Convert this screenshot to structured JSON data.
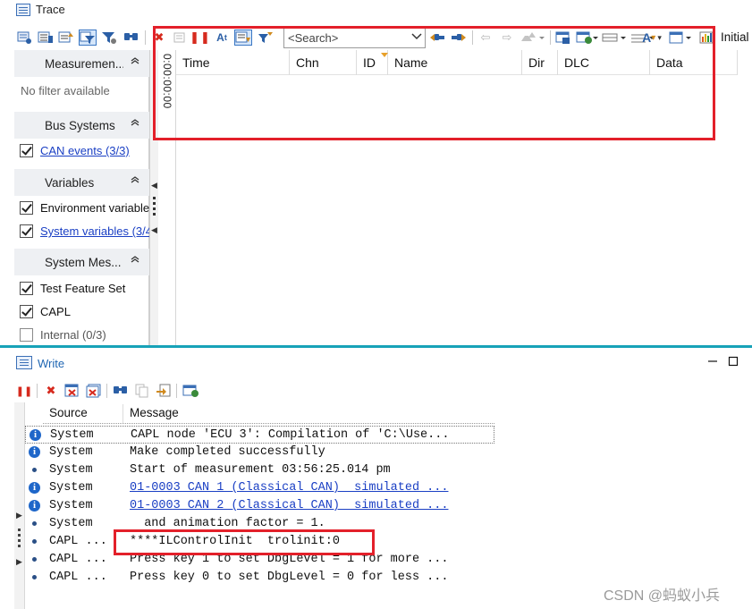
{
  "trace": {
    "title": "Trace",
    "search_placeholder": "<Search>",
    "initial_label": "Initial",
    "filter_pane": {
      "measurement_header": "Measuremen...",
      "no_filter_text": "No filter available",
      "bus_systems_header": "Bus Systems",
      "can_events": "CAN events (3/3)",
      "variables_header": "Variables",
      "environment_variables": "Environment variables",
      "system_variables": "System variables (3/4",
      "system_messages_header": "System Mes...",
      "test_feature_set": "Test Feature Set",
      "capl": "CAPL",
      "internal": "Internal (0/3)"
    },
    "time_strip": "0:00:00:00",
    "columns": [
      "Time",
      "Chn",
      "ID",
      "Name",
      "Dir",
      "DLC",
      "Data"
    ]
  },
  "write": {
    "title": "Write",
    "columns": [
      "Source",
      "Message"
    ],
    "rows": [
      {
        "icon": "info",
        "source": "System",
        "message": "CAPL node 'ECU 3': Compilation of 'C:\\Use..."
      },
      {
        "icon": "info",
        "source": "System",
        "message": "Make completed successfully"
      },
      {
        "icon": "dot",
        "source": "System",
        "message": "Start of measurement 03:56:25.014 pm"
      },
      {
        "icon": "info",
        "source": "System",
        "message": "01-0003 CAN 1 (Classical CAN)  simulated ..."
      },
      {
        "icon": "info",
        "source": "System",
        "message": "01-0003 CAN 2 (Classical CAN)  simulated ..."
      },
      {
        "icon": "dot",
        "source": "System",
        "message": "  and animation factor = 1."
      },
      {
        "icon": "dot",
        "source": "CAPL ...",
        "message": "****ILControlInit  trolinit:0"
      },
      {
        "icon": "dot",
        "source": "CAPL ...",
        "message": "Press key 1 to set DbgLevel = 1 for more ..."
      },
      {
        "icon": "dot",
        "source": "CAPL ...",
        "message": "Press key 0 to set DbgLevel = 0 for less ..."
      }
    ]
  },
  "watermark": "CSDN @蚂蚁小兵",
  "colors": {
    "highlight_red": "#e3202a",
    "link_blue": "#1a3fc4",
    "info_icon_blue": "#1e66c9",
    "split_teal": "#17a2b8"
  }
}
